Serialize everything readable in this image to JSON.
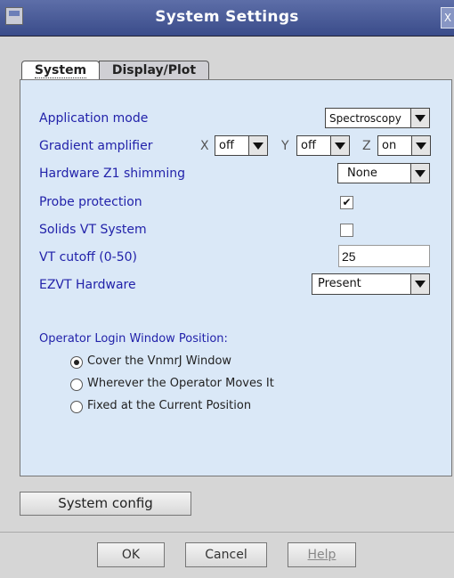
{
  "window": {
    "title": "System Settings",
    "close_symbol": "X"
  },
  "tabs": [
    {
      "label": "System"
    },
    {
      "label": "Display/Plot"
    }
  ],
  "settings": {
    "application_mode": {
      "label": "Application mode",
      "value": "Spectroscopy"
    },
    "gradient_amplifier": {
      "label": "Gradient amplifier",
      "x_label": "X",
      "x_value": "off",
      "y_label": "Y",
      "y_value": "off",
      "z_label": "Z",
      "z_value": "on"
    },
    "hardware_z1": {
      "label": "Hardware Z1 shimming",
      "value": "None"
    },
    "probe_protection": {
      "label": "Probe protection",
      "checked": true,
      "mark": "✔"
    },
    "solids_vt": {
      "label": "Solids VT System",
      "checked": false
    },
    "vt_cutoff": {
      "label": "VT cutoff (0-50)",
      "value": "25"
    },
    "ezvt": {
      "label": "EZVT Hardware",
      "value": "Present"
    }
  },
  "operator_login": {
    "heading": "Operator Login Window Position:",
    "options": [
      {
        "label": "Cover the VnmrJ Window",
        "selected": true
      },
      {
        "label": "Wherever the Operator Moves It",
        "selected": false
      },
      {
        "label": "Fixed at the Current Position",
        "selected": false
      }
    ]
  },
  "buttons": {
    "system_config": "System config",
    "ok": "OK",
    "cancel": "Cancel",
    "help": "Help"
  }
}
